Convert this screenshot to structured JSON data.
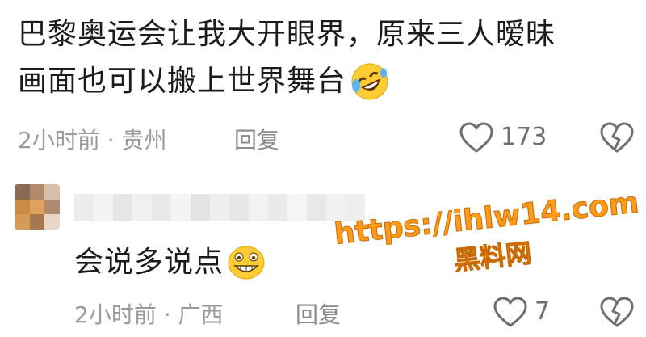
{
  "comment1": {
    "line1": "巴黎奥运会让我大开眼界，原来三人暧昧",
    "line2": "画面也可以搬上世界舞台",
    "emoji": "rolling-laughing-face-icon",
    "time_location": "2小时前 · 贵州",
    "reply_label": "回复",
    "like_count": "173"
  },
  "reply1": {
    "text": "会说多说点",
    "emoji": "grinning-face-icon",
    "time_location": "2小时前 · 广西",
    "reply_label": "回复",
    "like_count": "7"
  },
  "watermark": {
    "url": "https://ihlw14.com",
    "label": "黑料网"
  },
  "colors": {
    "text": "#1b1b1b",
    "meta": "#9a9a9a",
    "watermark": "#ff9a1a"
  }
}
